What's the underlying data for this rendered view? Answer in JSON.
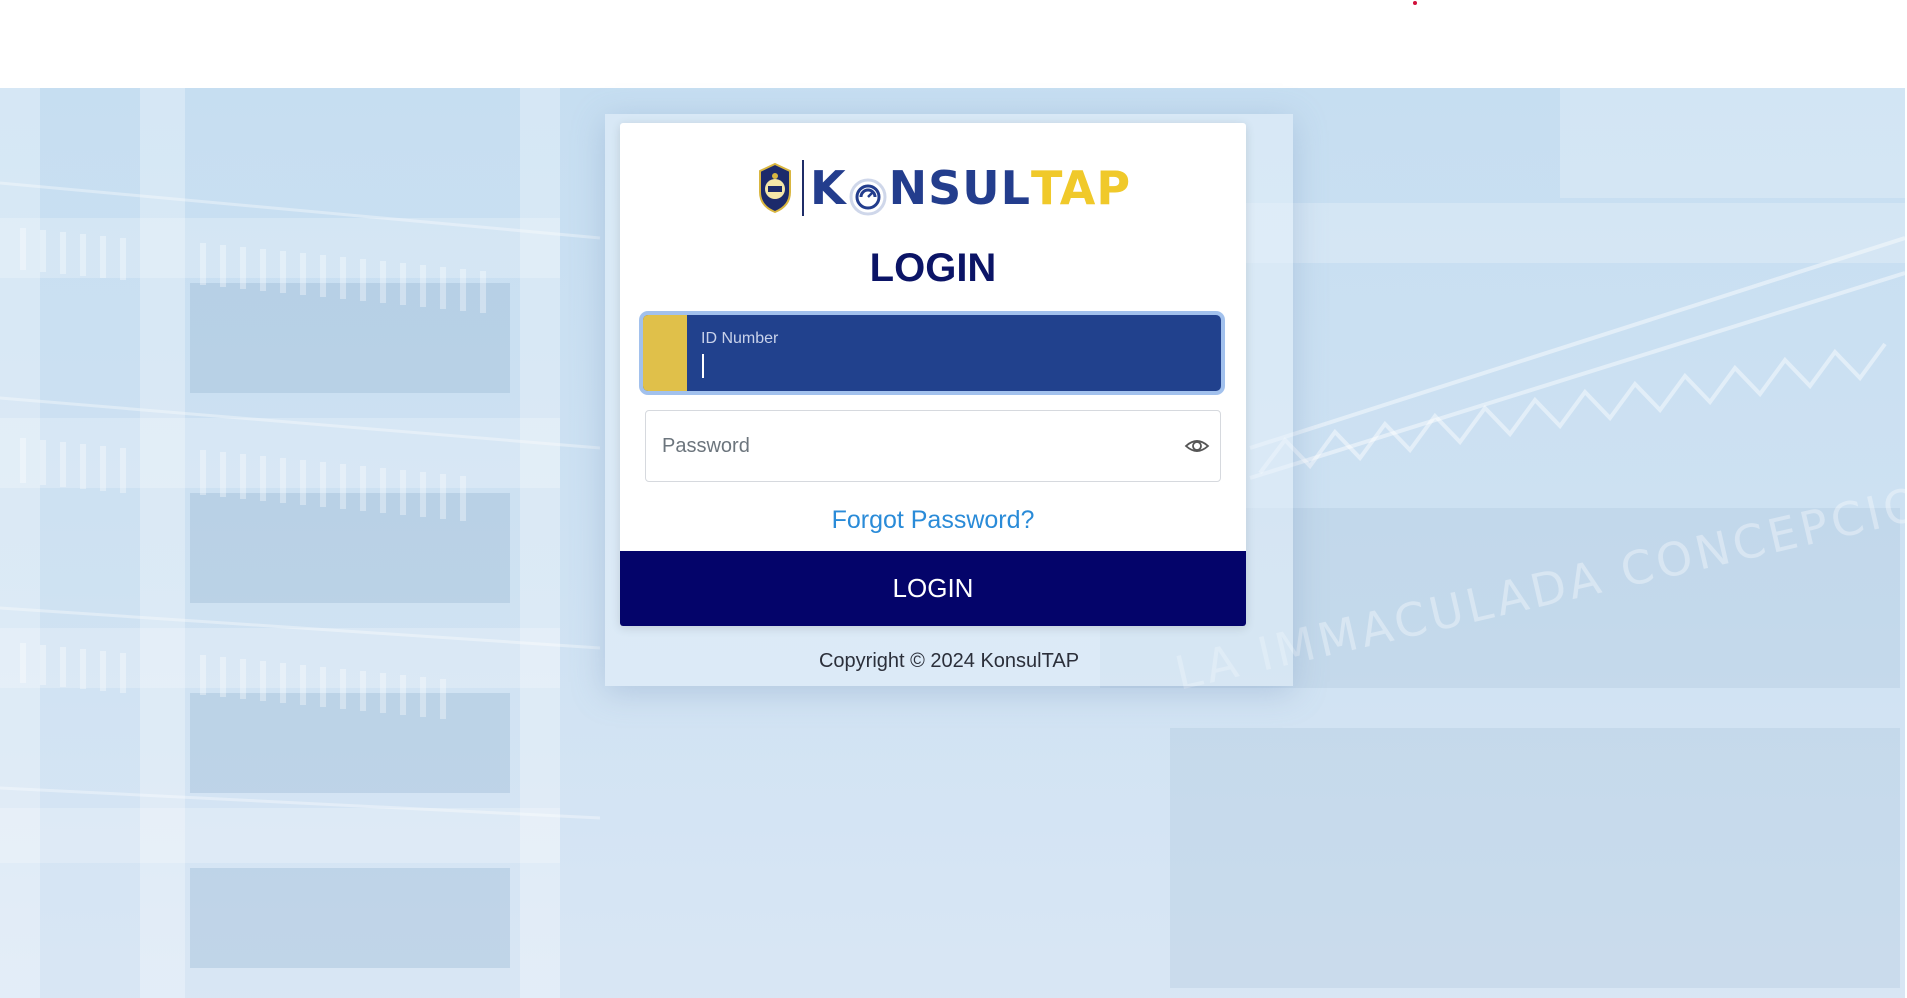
{
  "brand": {
    "part1": "K",
    "part2": "NSUL",
    "part3": "TAP"
  },
  "login": {
    "title": "LOGIN",
    "id_label": "ID Number",
    "password_placeholder": "Password",
    "forgot_link": "Forgot Password?",
    "submit_label": "LOGIN"
  },
  "footer": {
    "copyright": "Copyright © 2024 KonsulTAP"
  },
  "background": {
    "building_text": "LA IMMACULADA CONCEPCION SCH"
  },
  "colors": {
    "navy": "#04046a",
    "brand_blue": "#233d8d",
    "brand_yellow": "#f0c92a",
    "input_active": "#21418d",
    "link": "#2a8bd8"
  },
  "icons": {
    "password_toggle": "eye-icon",
    "school_seal": "school-seal-icon"
  }
}
